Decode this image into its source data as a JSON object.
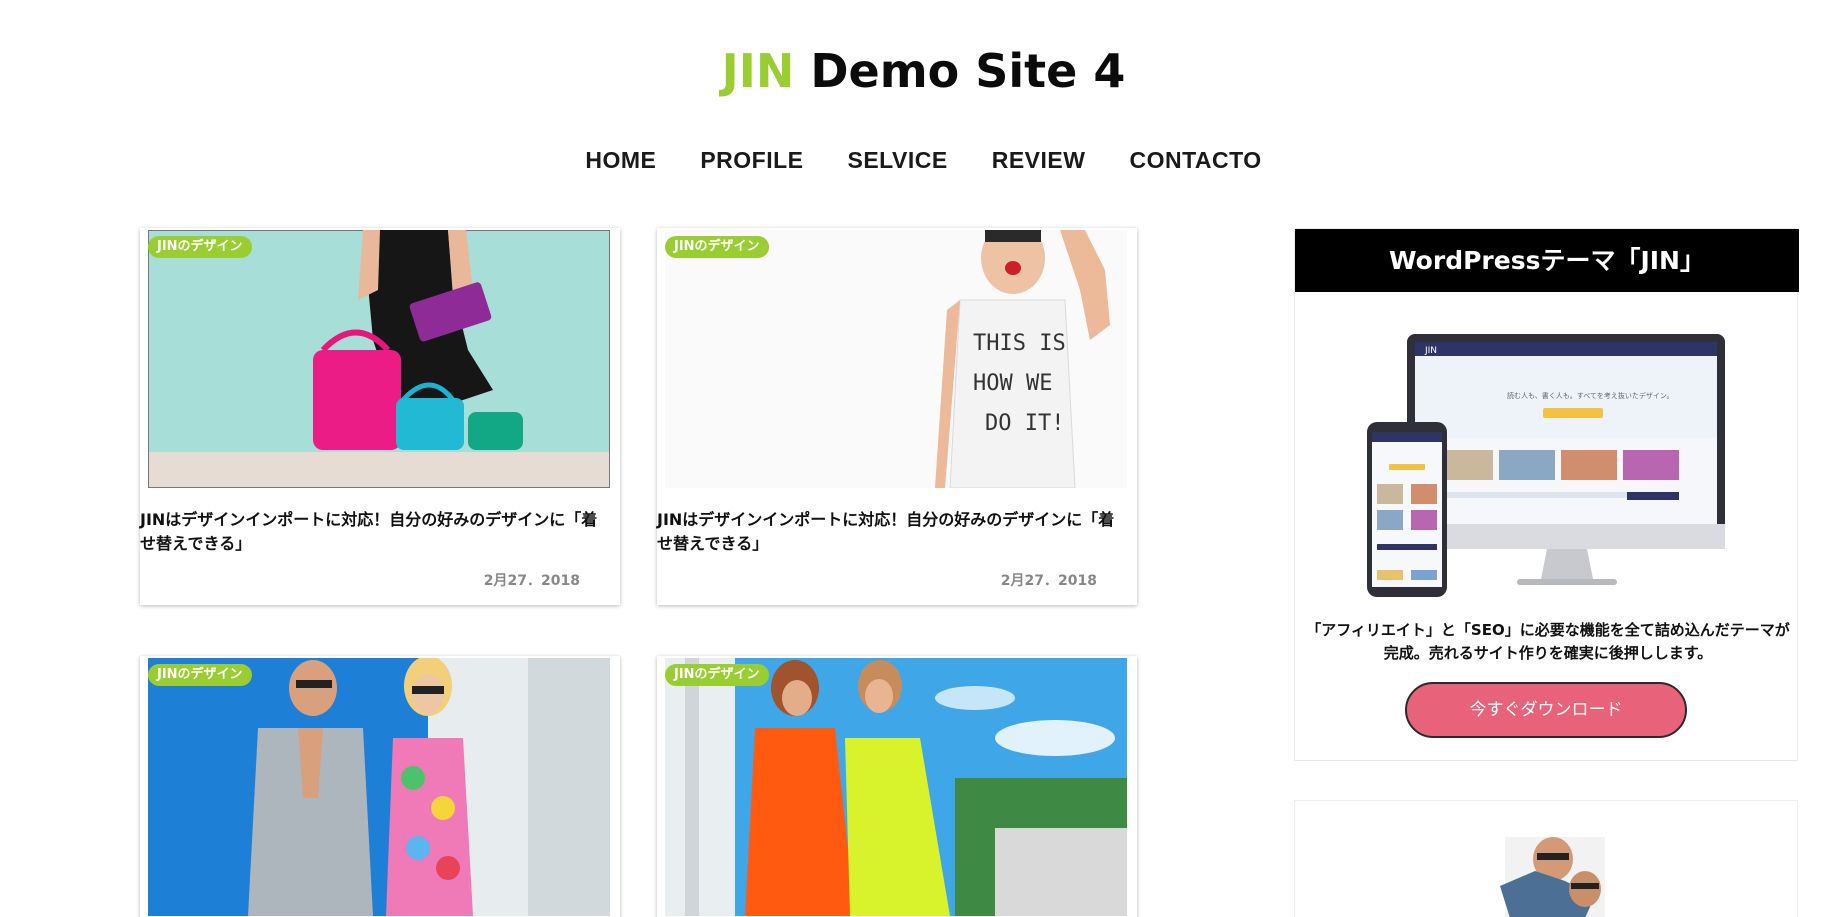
{
  "site": {
    "title_accent": "JIN",
    "title_rest": " Demo Site 4",
    "accent_color": "#9acd32"
  },
  "nav": {
    "items": [
      {
        "label": "HOME"
      },
      {
        "label": "PROFILE"
      },
      {
        "label": "SELVICE"
      },
      {
        "label": "REVIEW"
      },
      {
        "label": "CONTACTO"
      }
    ]
  },
  "posts": [
    {
      "category": "JINのデザイン",
      "title": "JINはデザインインポートに対応！自分の好みのデザインに「着せ替えできる」",
      "date": "2月27．2018"
    },
    {
      "category": "JINのデザイン",
      "title": "JINはデザインインポートに対応！自分の好みのデザインに「着せ替えできる」",
      "date": "2月27．2018"
    },
    {
      "category": "JINのデザイン"
    },
    {
      "category": "JINのデザイン"
    }
  ],
  "sidebar": {
    "heading": "WordPressテーマ「JIN」",
    "description": "「アフィリエイト」と「SEO」に必要な機能を全て詰め込んだテーマが完成。売れるサイト作りを確実に後押しします。",
    "button_label": "今すぐダウンロード",
    "button_color": "#e8627a",
    "mock_logo": "JIN",
    "mock_tagline": "読む人も、書く人も。すべてを考え抜いたデザイン。"
  }
}
